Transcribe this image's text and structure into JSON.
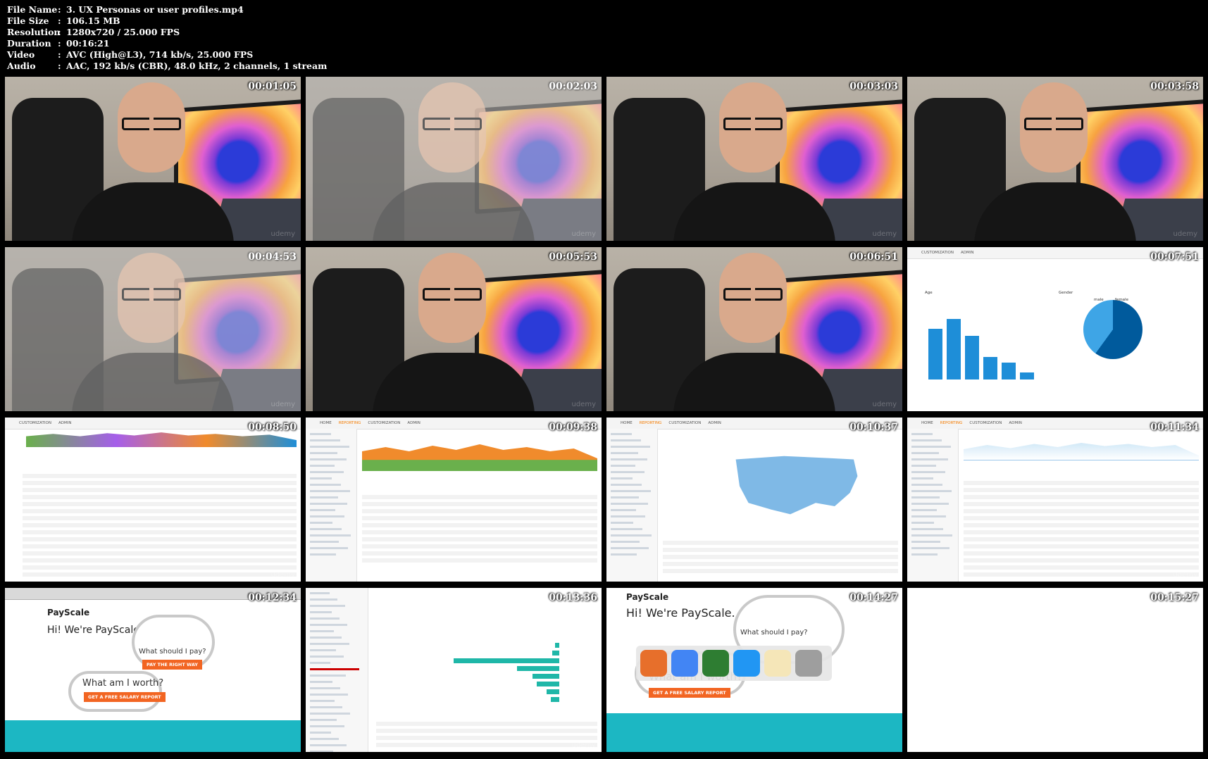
{
  "header": {
    "rows": [
      {
        "key": "File Name",
        "value": "3. UX Personas or user profiles.mp4"
      },
      {
        "key": "File Size",
        "value": "106.15 MB"
      },
      {
        "key": "Resolution",
        "value": "1280x720 / 25.000 FPS"
      },
      {
        "key": "Duration",
        "value": "00:16:21"
      },
      {
        "key": "Video",
        "value": "AVC (High@L3), 714 kb/s, 25.000 FPS"
      },
      {
        "key": "Audio",
        "value": "AAC, 192 kb/s (CBR), 48.0 kHz, 2 channels, 1 stream"
      }
    ]
  },
  "thumbnails": [
    {
      "timestamp": "00:01:05",
      "scene": "person"
    },
    {
      "timestamp": "00:02:03",
      "scene": "person-faded"
    },
    {
      "timestamp": "00:03:03",
      "scene": "person"
    },
    {
      "timestamp": "00:03:58",
      "scene": "person"
    },
    {
      "timestamp": "00:04:53",
      "scene": "person-faded"
    },
    {
      "timestamp": "00:05:53",
      "scene": "person"
    },
    {
      "timestamp": "00:06:51",
      "scene": "person"
    },
    {
      "timestamp": "00:07:51",
      "scene": "analytics-age-gender"
    },
    {
      "timestamp": "00:08:50",
      "scene": "analytics-table"
    },
    {
      "timestamp": "00:09:38",
      "scene": "analytics-area"
    },
    {
      "timestamp": "00:10:37",
      "scene": "analytics-map"
    },
    {
      "timestamp": "00:11:34",
      "scene": "analytics-line"
    },
    {
      "timestamp": "00:12:34",
      "scene": "payscale-browser"
    },
    {
      "timestamp": "00:13:36",
      "scene": "youtube-analytics"
    },
    {
      "timestamp": "00:14:27",
      "scene": "payscale-dock"
    },
    {
      "timestamp": "00:15:27",
      "scene": "blank"
    }
  ],
  "watermark": "udemy",
  "payscale": {
    "logo": "PayScale",
    "headline": "Hi! We're PayScale.",
    "question1": "What should I pay?",
    "button1": "PAY THE RIGHT WAY",
    "question2": "What am I worth?",
    "button2": "GET A FREE SALARY REPORT"
  },
  "analytics": {
    "tab_home": "HOME",
    "tab_reporting": "REPORTING",
    "tab_customization": "CUSTOMIZATION",
    "tab_admin": "ADMIN",
    "age_label": "Age",
    "gender_label": "Gender",
    "male": "male",
    "female": "female"
  },
  "age_chart": {
    "type": "bar",
    "values": [
      72,
      86,
      62,
      32,
      24,
      10
    ]
  },
  "gender_chart": {
    "type": "pie",
    "values": [
      60,
      40
    ]
  },
  "colors": {
    "accent_orange": "#f57c00",
    "ga_blue": "#1e8ed8",
    "payscale_orange": "#f26522",
    "payscale_teal": "#1cb7c3"
  }
}
